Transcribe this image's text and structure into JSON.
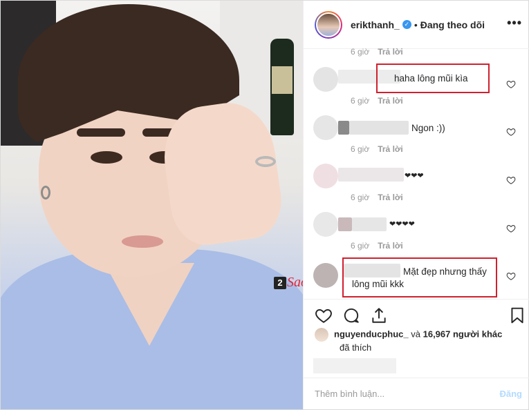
{
  "post": {
    "username": "erikthanh_",
    "verified_mark": "✓",
    "separator": "•",
    "follow_status": "Đang theo dõi",
    "more_label": "•••"
  },
  "watermark": {
    "number": "2",
    "text": "Sao"
  },
  "comments": [
    {
      "time": "6 giờ",
      "reply": "Trả lời",
      "text": ""
    },
    {
      "time": "6 giờ",
      "reply": "Trả lời",
      "text": "haha lông mũi kìa"
    },
    {
      "time": "6 giờ",
      "reply": "Trả lời",
      "text": "Ngon :))"
    },
    {
      "time": "6 giờ",
      "reply": "Trả lời",
      "text": "❤❤❤"
    },
    {
      "time": "6 giờ",
      "reply": "Trả lời",
      "text": "❤❤❤❤"
    },
    {
      "time": "",
      "reply": "",
      "text": "Mặt đẹp nhưng thấy",
      "text2": "lông mũi kkk"
    }
  ],
  "likes": {
    "user": "nguyenducphuc_",
    "conj": "và",
    "count_text": "16,967 người khác",
    "liked_text": "đã thích"
  },
  "comment_box": {
    "placeholder": "Thêm bình luận...",
    "post_label": "Đăng"
  },
  "colors": {
    "accent": "#3897f0",
    "highlight_box": "#d0202e",
    "post_disabled": "#b3dbff"
  },
  "icons": [
    "more-icon",
    "verified-icon",
    "heart-icon",
    "comment-icon",
    "share-icon",
    "bookmark-icon"
  ]
}
